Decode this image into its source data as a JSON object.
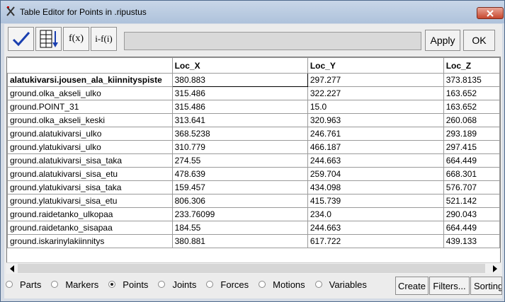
{
  "window": {
    "title": "Table Editor for Points in .ripustus"
  },
  "toolbar": {
    "icons": [
      "checkmark-icon",
      "table-sort-icon",
      "function-icon",
      "info-function-icon"
    ],
    "function_label": "f(x)",
    "info_label": "i-f(i)",
    "entry_value": "",
    "apply_label": "Apply",
    "ok_label": "OK"
  },
  "table": {
    "columns": [
      "Loc_X",
      "Loc_Y",
      "Loc_Z"
    ],
    "rows": [
      {
        "name": "alatukivarsi.jousen_ala_kiinnityspiste",
        "x": "380.883",
        "y": "297.277",
        "z": "373.8135"
      },
      {
        "name": "ground.olka_akseli_ulko",
        "x": "315.486",
        "y": "322.227",
        "z": "163.652"
      },
      {
        "name": "ground.POINT_31",
        "x": "315.486",
        "y": "15.0",
        "z": "163.652"
      },
      {
        "name": "ground.olka_akseli_keski",
        "x": "313.641",
        "y": "320.963",
        "z": "260.068"
      },
      {
        "name": "ground.alatukivarsi_ulko",
        "x": "368.5238",
        "y": "246.761",
        "z": "293.189"
      },
      {
        "name": "ground.ylatukivarsi_ulko",
        "x": "310.779",
        "y": "466.187",
        "z": "297.415"
      },
      {
        "name": "ground.alatukivarsi_sisa_taka",
        "x": "274.55",
        "y": "244.663",
        "z": "664.449"
      },
      {
        "name": "ground.alatukivarsi_sisa_etu",
        "x": "478.639",
        "y": "259.704",
        "z": "668.301"
      },
      {
        "name": "ground.ylatukivarsi_sisa_taka",
        "x": "159.457",
        "y": "434.098",
        "z": "576.707"
      },
      {
        "name": "ground.ylatukivarsi_sisa_etu",
        "x": "806.306",
        "y": "415.739",
        "z": "521.142"
      },
      {
        "name": "ground.raidetanko_ulkopaa",
        "x": "233.76099",
        "y": "234.0",
        "z": "290.043"
      },
      {
        "name": "ground.raidetanko_sisapaa",
        "x": "184.55",
        "y": "244.663",
        "z": "664.449"
      },
      {
        "name": "ground.iskarinylakiinnitys",
        "x": "380.881",
        "y": "617.722",
        "z": "439.133"
      }
    ]
  },
  "filters": {
    "options": [
      "Parts",
      "Markers",
      "Points",
      "Joints",
      "Forces",
      "Motions",
      "Variables"
    ],
    "selected": "Points"
  },
  "bottom_buttons": {
    "create_label": "Create",
    "filters_label": "Filters...",
    "sorting_label": "Sorting"
  }
}
